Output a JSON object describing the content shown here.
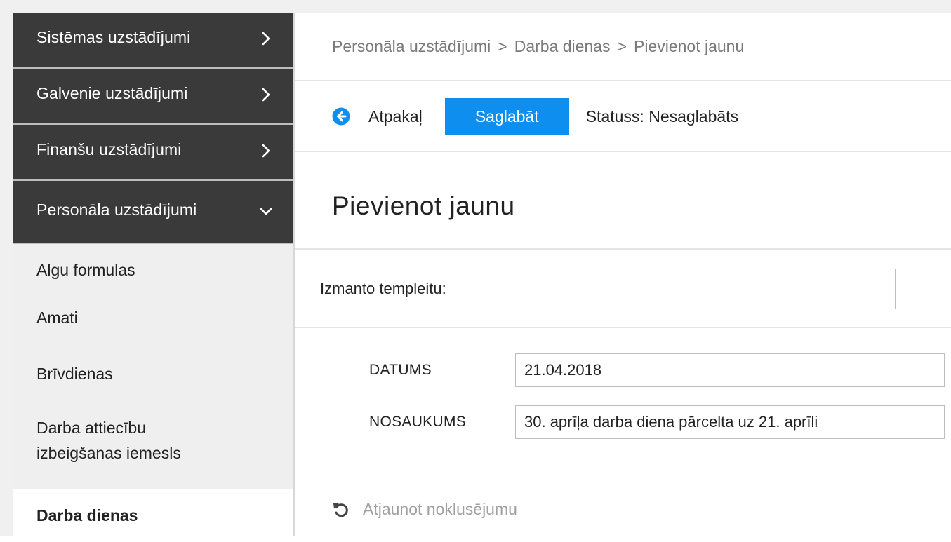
{
  "sidebar": {
    "groups": [
      {
        "label": "Sistēmas uzstādījumi",
        "icon": "chevron-right-icon"
      },
      {
        "label": "Galvenie uzstādījumi",
        "icon": "chevron-right-icon"
      },
      {
        "label": "Finanšu uzstādījumi",
        "icon": "chevron-right-icon"
      },
      {
        "label": "Personāla uzstādījumi",
        "icon": "chevron-down-icon"
      }
    ],
    "items": [
      {
        "label": "Algu formulas"
      },
      {
        "label": "Amati"
      },
      {
        "label": "Brīvdienas"
      },
      {
        "label": "Darba attiecību izbeigšanas iemesls"
      },
      {
        "label": "Darba dienas"
      }
    ]
  },
  "breadcrumb": {
    "items": [
      "Personāla uzstādījumi",
      "Darba dienas",
      "Pievienot jaunu"
    ],
    "separator": ">"
  },
  "toolbar": {
    "back_label": "Atpakaļ",
    "save_label": "Saglabāt",
    "status_text": "Statuss: Nesaglabāts",
    "back_icon": "arrow-left-circle-icon"
  },
  "page_title": "Pievienot jaunu",
  "template": {
    "label": "Izmanto templeitu:",
    "value": ""
  },
  "fields": [
    {
      "label": "DATUMS",
      "value": "21.04.2018"
    },
    {
      "label": "NOSAUKUMS",
      "value": "30. aprīļa darba diena pārcelta uz 21. aprīli"
    }
  ],
  "reset": {
    "label": "Atjaunot noklusējumu",
    "icon": "undo-icon"
  },
  "colors": {
    "sidebar_dark": "#3a3a3a",
    "accent": "#0e8ff0",
    "muted_text": "#7a7a7a"
  }
}
